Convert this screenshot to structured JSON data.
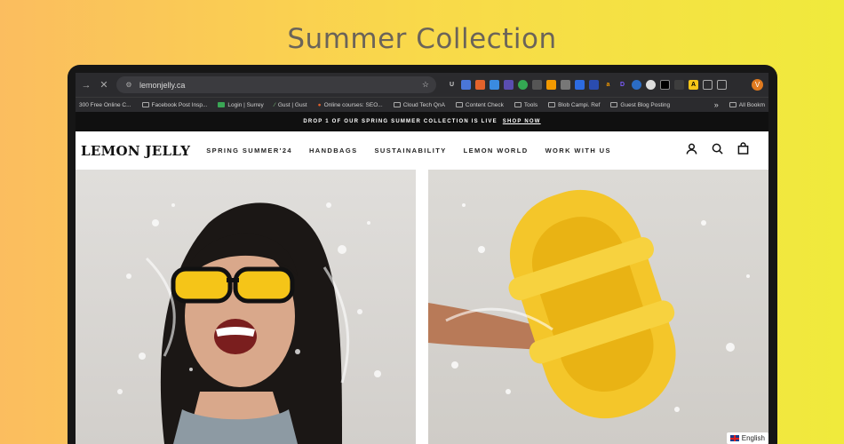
{
  "headline": "Summer Collection",
  "browser": {
    "url": "lemonjelly.ca",
    "profile_initial": "V",
    "extensions": [
      "U",
      "",
      "",
      "",
      "",
      "",
      "",
      "",
      "",
      "",
      "",
      "a",
      "D",
      "",
      "",
      "",
      "",
      "A",
      "",
      ""
    ],
    "bookmarks": [
      "300 Free Online C...",
      "Facebook Post Insp...",
      "Login | Surrey",
      "Gust | Gust",
      "Online courses: SEO...",
      "Cloud Tech QnA",
      "Content Check",
      "Tools",
      "Blob Campi. Ref",
      "Guest Blog Posting",
      "All Bookm"
    ]
  },
  "site": {
    "announcement": "DROP 1 OF OUR SPRING SUMMER COLLECTION IS LIVE",
    "announcement_link": "SHOP NOW",
    "logo": "LEMON JELLY",
    "menu": [
      "SPRING SUMMER'24",
      "HANDBAGS",
      "SUSTAINABILITY",
      "LEMON WORLD",
      "WORK WITH US"
    ],
    "language": "English"
  },
  "colors": {
    "bg_left": "#fbbd5f",
    "bg_right": "#f0ea3c",
    "headline": "#6b6459",
    "sunglasses": "#f5c518",
    "sandal": "#f4c62a"
  }
}
